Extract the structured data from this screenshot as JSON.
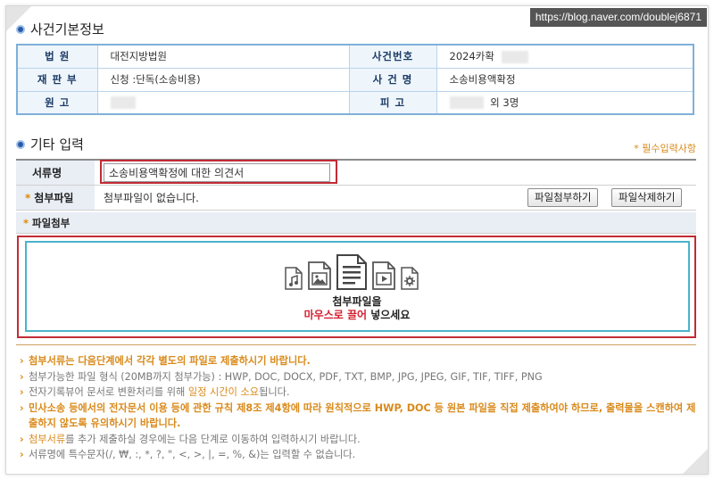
{
  "watermark": "https://blog.naver.com/doublej6871",
  "case_info": {
    "title": "사건기본정보",
    "rows": [
      {
        "h1": "법 원",
        "v1": "대전지방법원",
        "h2": "사건번호",
        "v2": "2024카확"
      },
      {
        "h1": "재 판 부",
        "v1": "신청 :단독(소송비용)",
        "h2": "사 건 명",
        "v2": "소송비용액확정"
      },
      {
        "h1": "원 고",
        "v1": "",
        "h2": "피 고",
        "v2": "외 3명"
      }
    ]
  },
  "etc": {
    "title": "기타 입력",
    "required_note": "* 필수입력사항",
    "doc_name_label": "서류명",
    "doc_name_value": "소송비용액확정에 대한 의견서",
    "attach_label": "첨부파일",
    "attach_text": "첨부파일이 없습니다.",
    "attach_button": "파일첨부하기",
    "delete_button": "파일삭제하기",
    "file_attach_label": "파일첨부",
    "drop_line1": "첨부파일을",
    "drop_line2_red": "마우스로 끌어",
    "drop_line2_rest": " 넣으세요",
    "icons": [
      "audio-file-icon",
      "image-file-icon",
      "document-file-icon",
      "video-file-icon",
      "settings-file-icon"
    ]
  },
  "notes": {
    "n1": "첨부서류는 다음단계에서 각각 별도의 파일로 제출하시기 바랍니다.",
    "n2": "첨부가능한 파일 형식 (20MB까지 첨부가능) : HWP, DOC, DOCX, PDF, TXT, BMP, JPG, JPEG, GIF, TIF, TIFF, PNG",
    "n3_a": "전자기록뷰어 문서로 변환처리를 위해 ",
    "n3_b": "일정 시간이 소요",
    "n3_c": "됩니다.",
    "n4": "민사소송 등에서의 전자문서 이용 등에 관한 규칙 제8조 제4항에 따라 원칙적으로 HWP, DOC 등 원본 파일을 직접 제출하여야 하므로, 출력물을 스캔하여 제출하지 않도록 유의하시기 바랍니다.",
    "n5_a": "첨부서류",
    "n5_b": "를 추가 제출하실 경우에는 다음 단계로 이동하여 입력하시기 바랍니다.",
    "n6": "서류명에 특수문자(/, ₩, :, *, ?, \", <, >, |, =, %, &)는 입력할 수 없습니다."
  },
  "colors": {
    "accent_blue": "#2a5aa8",
    "highlight_red": "#c22b36",
    "orange": "#d98a1b",
    "drop_border": "#4bb3cc"
  }
}
